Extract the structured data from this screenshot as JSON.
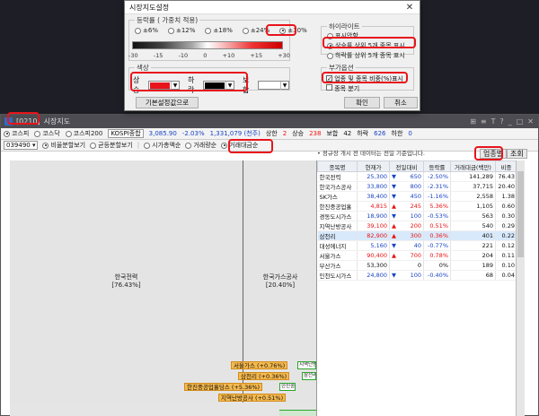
{
  "dialog": {
    "title": "시장지도설정",
    "close_glyph": "✕",
    "rate_group_label": "등락률 ( 가중치 적용)",
    "rate_options": [
      "±6%",
      "±12%",
      "±18%",
      "±24%",
      "±30%"
    ],
    "rate_selected": "±30%",
    "scale": [
      "-30",
      "-15",
      "-10",
      "0",
      "+10",
      "+15",
      "+30"
    ],
    "color_group_label": "색상",
    "up_label": "상승",
    "down_label": "하락",
    "flat_label": "보합",
    "colors": {
      "up": "#e8141c",
      "down": "#000000",
      "flat": "#ffffff"
    },
    "highlight_group_label": "하이라이트",
    "highlight_options": [
      "표시안함",
      "상승률 상위 5개 종목 표시",
      "하락률 상위 5개 종목 표시"
    ],
    "highlight_selected": "상승률 상위 5개 종목 표시",
    "extra_group_label": "부가옵션",
    "extra_options": [
      "업종 및 종목 비중(%)표시",
      "종목 분기"
    ],
    "extra_checked": "업종 및 종목 비중(%)표시",
    "default_button": "기본설정값으로",
    "ok_button": "확인",
    "cancel_button": "취소"
  },
  "app": {
    "screen_no": "[0210]",
    "title": "시장지도",
    "title_controls": [
      "⊞",
      "≡",
      "T",
      "?",
      "_",
      "□",
      "✕"
    ],
    "markets": [
      "코스피",
      "코스닥",
      "코스피200"
    ],
    "market_selected": "코스피",
    "index_name": "KOSPI종합",
    "index_value": "3,085.90",
    "index_change": "-2.03%",
    "volume": "1,331,079 (천주)",
    "up_label": "상한",
    "up_count": "2",
    "rise_label": "상승",
    "rise_count": "238",
    "flat_label": "보합",
    "flat_count": "42",
    "fall_label": "하락",
    "fall_count": "626",
    "lower_label": "하한",
    "lower_count": "0",
    "sector_code": "039490",
    "view_options": [
      "비율분할보기",
      "균등분할보기",
      "시가총액순",
      "거래량순",
      "거래대금순"
    ],
    "view_selected": "비율분할보기",
    "sort_selected": "거래대금순",
    "notice": "• 정규장 개시 전 데이터는 전일 기준입니다.",
    "sector_button": "업종별",
    "query_button": "조회"
  },
  "treemap": {
    "tiles": [
      {
        "name": "한국전력",
        "weight": "[76.43%]"
      },
      {
        "name": "한국가스공사",
        "weight": "[20.40%]"
      }
    ],
    "tooltips": [
      "서울가스 (+0.76%)",
      "삼천리 (+0.36%)",
      "한진중공업홀딩스 (+5.36%)",
      "지역난방공사 (+0.51%)"
    ],
    "mini_labels": [
      "지역난방",
      "삼천리",
      "한진중"
    ]
  },
  "table": {
    "headers": [
      "종목명",
      "현재가",
      "전일대비",
      "등락률",
      "거래대금(백만)",
      "비중"
    ],
    "rows": [
      {
        "name": "한국전력",
        "price": "25,300",
        "dir": "down",
        "change": "650",
        "rate": "-2.50%",
        "amount": "141,289",
        "weight": "76.43"
      },
      {
        "name": "한국가스공사",
        "price": "33,800",
        "dir": "down",
        "change": "800",
        "rate": "-2.31%",
        "amount": "37,715",
        "weight": "20.40"
      },
      {
        "name": "SK가스",
        "price": "38,400",
        "dir": "down",
        "change": "450",
        "rate": "-1.16%",
        "amount": "2,558",
        "weight": "1.38"
      },
      {
        "name": "한진중공업홀",
        "price": "4,815",
        "dir": "up",
        "change": "245",
        "rate": "5.36%",
        "amount": "1,105",
        "weight": "0.60"
      },
      {
        "name": "경동도시가스",
        "price": "18,900",
        "dir": "down",
        "change": "100",
        "rate": "-0.53%",
        "amount": "563",
        "weight": "0.30"
      },
      {
        "name": "지역난방공사",
        "price": "39,100",
        "dir": "up",
        "change": "200",
        "rate": "0.51%",
        "amount": "540",
        "weight": "0.29"
      },
      {
        "name": "삼천리",
        "price": "82,900",
        "dir": "up",
        "change": "300",
        "rate": "0.36%",
        "amount": "401",
        "weight": "0.22"
      },
      {
        "name": "대성에너지",
        "price": "5,160",
        "dir": "down",
        "change": "40",
        "rate": "-0.77%",
        "amount": "221",
        "weight": "0.12"
      },
      {
        "name": "서울가스",
        "price": "90,400",
        "dir": "up",
        "change": "700",
        "rate": "0.78%",
        "amount": "204",
        "weight": "0.11"
      },
      {
        "name": "부산가스",
        "price": "53,300",
        "dir": "flat",
        "change": "0",
        "rate": "0%",
        "amount": "189",
        "weight": "0.10"
      },
      {
        "name": "인천도시가스",
        "price": "24,800",
        "dir": "down",
        "change": "100",
        "rate": "-0.40%",
        "amount": "68",
        "weight": "0.04"
      }
    ],
    "selected_row": "삼천리"
  }
}
